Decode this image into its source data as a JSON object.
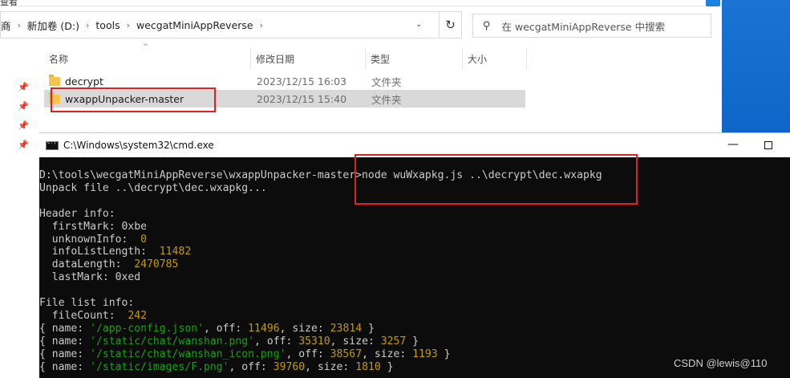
{
  "explorer": {
    "top_fragment": "查看",
    "breadcrumb": [
      {
        "label": "商"
      },
      {
        "label": "新加卷 (D:)"
      },
      {
        "label": "tools"
      },
      {
        "label": "wecgatMiniAppReverse"
      }
    ],
    "search_placeholder": "在 wecgatMiniAppReverse 中搜索",
    "columns": {
      "name": "名称",
      "date": "修改日期",
      "type": "类型",
      "size": "大小"
    },
    "files": [
      {
        "name": "decrypt",
        "date": "2023/12/15 16:03",
        "type": "文件夹",
        "selected": false
      },
      {
        "name": "wxappUnpacker-master",
        "date": "2023/12/15 15:40",
        "type": "文件夹",
        "selected": true
      }
    ]
  },
  "cmd": {
    "title": "C:\\Windows\\system32\\cmd.exe",
    "prompt": "D:\\tools\\wecgatMiniAppReverse\\wxappUnpacker-master>",
    "command": "node wuWxapkg.js ..\\decrypt\\dec.wxapkg",
    "unpack_line": "Unpack file ..\\decrypt\\dec.wxapkg...",
    "header_title": "Header info:",
    "header": {
      "firstMark_label": "  firstMark: ",
      "firstMark": "0xbe",
      "unknownInfo_label": "  unknownInfo:  ",
      "unknownInfo": "0",
      "infoListLength_label": "  infoListLength:  ",
      "infoListLength": "11482",
      "dataLength_label": "  dataLength:  ",
      "dataLength": "2470785",
      "lastMark_label": "  lastMark: ",
      "lastMark": "0xed"
    },
    "filelist_title": "File list info:",
    "fileCount_label": "  fileCount:  ",
    "fileCount": "242",
    "entries": [
      {
        "name": "'/app-config.json'",
        "off": "11496",
        "size": "23814"
      },
      {
        "name": "'/static/chat/wanshan.png'",
        "off": "35310",
        "size": "3257"
      },
      {
        "name": "'/static/chat/wanshan_icon.png'",
        "off": "38567",
        "size": "1193"
      },
      {
        "name": "'/static/images/F.png'",
        "off": "39760",
        "size": "1810"
      }
    ]
  },
  "watermark": "CSDN @lewis@110"
}
